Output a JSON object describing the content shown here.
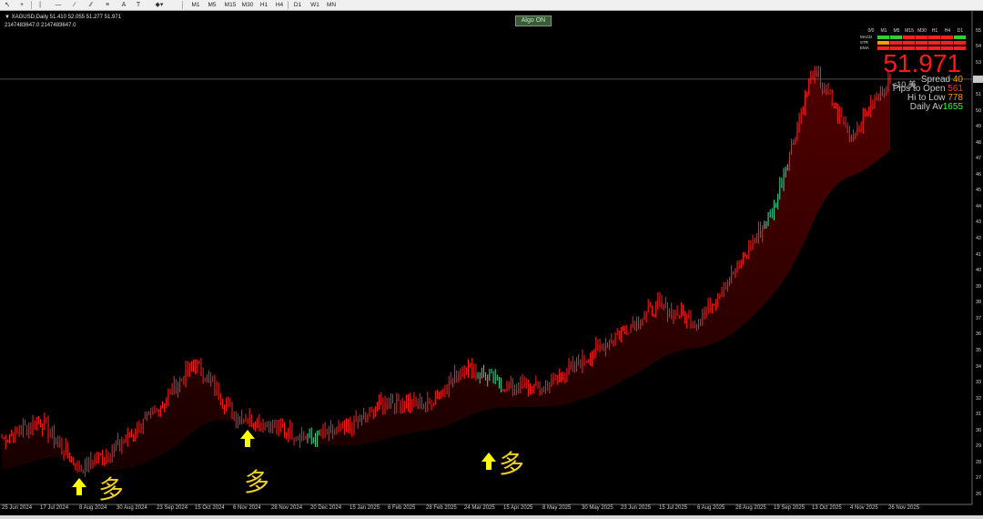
{
  "toolbar": {
    "timeframes": [
      "M1",
      "M5",
      "M15",
      "M30",
      "H1",
      "H4",
      "D1",
      "W1",
      "MN"
    ]
  },
  "chart": {
    "symbol_line": "XAGUSD,Daily  51.410 52.055 51.277 51.971",
    "sub_line": "2147483647.0   2147483647.0",
    "algo_button": "Algo ON",
    "price_display": "51.971",
    "price_sub": "<10 美",
    "stats": [
      {
        "label": "Spread",
        "value": "40",
        "color": "#ff9a00"
      },
      {
        "label": "Pips to Open",
        "value": "561",
        "color": "#ff3030"
      },
      {
        "label": "Hi to Low",
        "value": "778",
        "color": "#ff9a00"
      },
      {
        "label": "Daily Av",
        "value": "1655",
        "color": "#30ff30"
      }
    ],
    "tf_header_prefix": "0/0",
    "tf_headers": [
      "M1",
      "M5",
      "M15",
      "M30",
      "H1",
      "H4",
      "D1"
    ],
    "indicator_rows": [
      "MACD",
      "STR",
      "EMA"
    ],
    "markers": [
      "多",
      "多",
      "多"
    ],
    "x_labels": [
      "25 Jun 2024",
      "17 Jul 2024",
      "8 Aug 2024",
      "30 Aug 2024",
      "23 Sep 2024",
      "15 Oct 2024",
      "6 Nov 2024",
      "28 Nov 2024",
      "20 Dec 2024",
      "15 Jan 2025",
      "6 Feb 2025",
      "28 Feb 2025",
      "24 Mar 2025",
      "15 Apr 2025",
      "8 May 2025",
      "30 May 2025",
      "23 Jun 2025",
      "15 Jul 2025",
      "6 Aug 2025",
      "28 Aug 2025",
      "19 Sep 2025",
      "13 Oct 2025",
      "4 Nov 2025",
      "26 Nov 2025"
    ],
    "y_labels": [
      "55",
      "54",
      "53",
      "52",
      "51",
      "50",
      "49",
      "48",
      "47",
      "46",
      "45",
      "44",
      "43",
      "42",
      "41",
      "40",
      "39",
      "38",
      "37",
      "36",
      "35",
      "34",
      "33",
      "32",
      "31",
      "30",
      "29",
      "28",
      "27",
      "26"
    ],
    "colors": {
      "bear": "#ff2020",
      "bull": "#30e0a0",
      "fill": "#3a0000",
      "marker": "#ffff00"
    }
  },
  "chart_data": {
    "type": "line",
    "title": "XAGUSD,Daily",
    "x": [
      "25 Jun 2024",
      "17 Jul 2024",
      "8 Aug 2024",
      "30 Aug 2024",
      "23 Sep 2024",
      "15 Oct 2024",
      "6 Nov 2024",
      "28 Nov 2024",
      "20 Dec 2024",
      "15 Jan 2025",
      "6 Feb 2025",
      "28 Feb 2025",
      "24 Mar 2025",
      "15 Apr 2025",
      "8 May 2025",
      "30 May 2025",
      "23 Jun 2025",
      "15 Jul 2025",
      "6 Aug 2025",
      "28 Aug 2025",
      "19 Sep 2025",
      "13 Oct 2025",
      "4 Nov 2025",
      "26 Nov 2025"
    ],
    "series": [
      {
        "values": [
          29.5,
          30.6,
          27.6,
          29.0,
          31.2,
          34.3,
          31.0,
          30.3,
          29.5,
          30.2,
          31.9,
          31.6,
          34.0,
          32.8,
          32.6,
          34.3,
          36.2,
          37.8,
          36.8,
          40.0,
          44.0,
          52.5,
          48.5,
          51.97
        ]
      }
    ],
    "ylim": [
      26,
      55.5
    ]
  }
}
